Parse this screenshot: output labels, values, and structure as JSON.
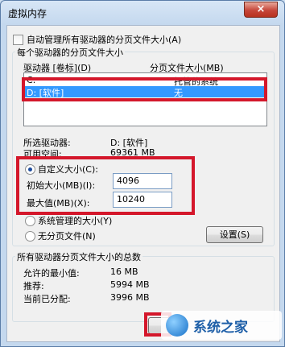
{
  "window": {
    "title": "虚拟内存",
    "close_icon": "×"
  },
  "auto_manage": {
    "label": "自动管理所有驱动器的分页文件大小(A)",
    "checked": false
  },
  "per_drive_group": {
    "title": "每个驱动器的分页文件大小",
    "col_drive": "驱动器 [卷标](D)",
    "col_paging": "分页文件大小(MB)",
    "rows": [
      {
        "drive": "C:",
        "size": "托管的系统",
        "selected": false
      },
      {
        "drive": "D:  [软件]",
        "size": "无",
        "selected": true
      }
    ]
  },
  "selected_drive": {
    "label": "所选驱动器:",
    "value": "D:  [软件]",
    "free_label": "可用空间:",
    "free_value": "69361 MB"
  },
  "custom_size": {
    "label": "自定义大小(C):",
    "checked": true,
    "initial_label": "初始大小(MB)(I):",
    "initial_value": "4096",
    "max_label": "最大值(MB)(X):",
    "max_value": "10240"
  },
  "system_managed": {
    "label": "系统管理的大小(Y)",
    "checked": false
  },
  "no_paging": {
    "label": "无分页文件(N)",
    "checked": false
  },
  "set_button": "设置(S)",
  "totals_group": {
    "title": "所有驱动器分页文件大小的总数",
    "min_label": "允许的最小值:",
    "min_value": "16 MB",
    "recommended_label": "推荐:",
    "recommended_value": "5994 MB",
    "current_label": "当前已分配:",
    "current_value": "3996 MB"
  },
  "watermark": {
    "text": "系统之家"
  },
  "colors": {
    "highlight": "#3399ff",
    "annotation_red": "#d4172b",
    "title_bar": "#c4d8ee"
  }
}
